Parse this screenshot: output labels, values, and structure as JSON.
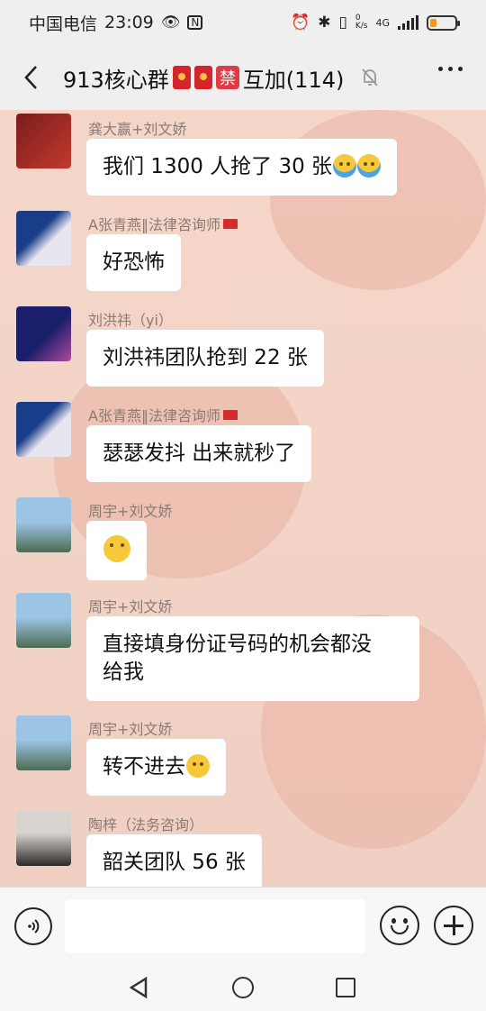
{
  "status_bar": {
    "carrier": "中国电信",
    "time": "23:09",
    "net_speed_value": "0",
    "net_speed_unit": "K/s",
    "network_type": "4G",
    "battery_level": 0.28,
    "battery_color": "#f39a1e"
  },
  "header": {
    "group_name": "913核心群",
    "ban_badge": "禁",
    "group_suffix": "互加(114)",
    "icons": [
      "back-arrow",
      "red-packet",
      "red-packet",
      "mute-bell",
      "more-dots"
    ]
  },
  "messages": [
    {
      "sender": "龚大赢+刘文娇",
      "text": "我们 1300 人抢了 30 张",
      "emoji": "cry-cry",
      "avatar_colors": [
        "#7a1c1c",
        "#c23a2e"
      ]
    },
    {
      "sender": "A张青燕‖法律咨询师",
      "sender_flag": true,
      "text": "好恐怖",
      "avatar_colors": [
        "#1a3d8a",
        "#e7e5ef"
      ]
    },
    {
      "sender": "刘洪祎（yi）",
      "text": "刘洪祎团队抢到 22 张",
      "avatar_colors": [
        "#1b1f6b",
        "#b04a9b"
      ]
    },
    {
      "sender": "A张青燕‖法律咨询师",
      "sender_flag": true,
      "text": "瑟瑟发抖 出来就秒了",
      "avatar_colors": [
        "#1a3d8a",
        "#e7e5ef"
      ]
    },
    {
      "sender": "周宇+刘文娇",
      "text": "",
      "emoji": "scared",
      "avatar_colors": [
        "#9cc4e4",
        "#4d6b52"
      ]
    },
    {
      "sender": "周宇+刘文娇",
      "text_line1": "直接填身份证号码的机会都没",
      "text_line2": "给我",
      "avatar_colors": [
        "#9cc4e4",
        "#4d6b52"
      ]
    },
    {
      "sender": "周宇+刘文娇",
      "text": "转不进去",
      "emoji": "laugh-cry",
      "avatar_colors": [
        "#9cc4e4",
        "#4d6b52"
      ]
    },
    {
      "sender": "陶梓（法务咨询）",
      "text": "韶关团队 56 张",
      "avatar_colors": [
        "#d7d4d0",
        "#2d2a28"
      ]
    }
  ],
  "input_bar": {
    "placeholder": "",
    "icons": [
      "voice-icon",
      "emoji-icon",
      "plus-icon"
    ]
  },
  "nav_bar": {
    "icons": [
      "back-triangle",
      "home-circle",
      "recent-square"
    ]
  }
}
